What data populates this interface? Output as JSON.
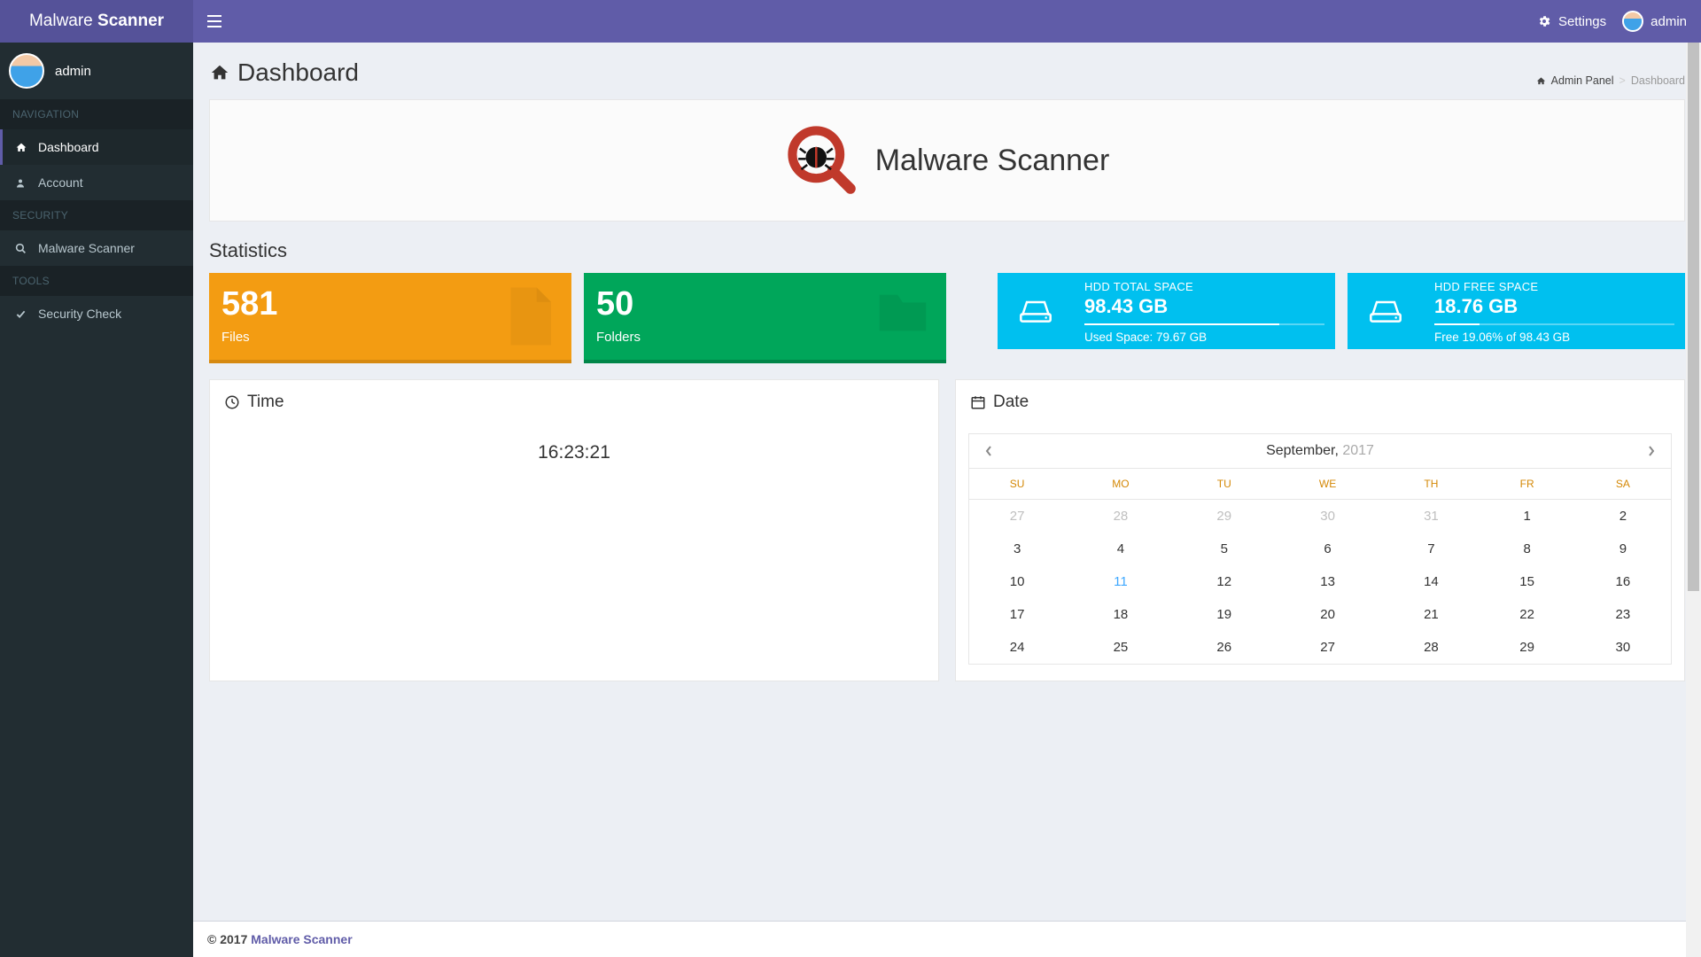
{
  "brand": {
    "part1": "Malware",
    "part2": "Scanner"
  },
  "topbar": {
    "settings": "Settings",
    "user": "admin"
  },
  "sidebar": {
    "user": "admin",
    "headers": {
      "navigation": "NAVIGATION",
      "security": "SECURITY",
      "tools": "TOOLS"
    },
    "items": {
      "dashboard": "Dashboard",
      "account": "Account",
      "malware_scanner": "Malware Scanner",
      "security_check": "Security Check"
    }
  },
  "page": {
    "title": "Dashboard",
    "hero": "Malware Scanner",
    "statistics_label": "Statistics"
  },
  "breadcrumb": {
    "home": "Admin Panel",
    "current": "Dashboard"
  },
  "stats": {
    "files": {
      "value": "581",
      "label": "Files"
    },
    "folders": {
      "value": "50",
      "label": "Folders"
    }
  },
  "disk": {
    "total": {
      "label": "HDD TOTAL SPACE",
      "value": "98.43 GB",
      "footer": "Used Space: 79.67 GB",
      "bar_pct": 81
    },
    "free": {
      "label": "HDD FREE SPACE",
      "value": "18.76 GB",
      "footer": "Free 19.06% of 98.43 GB",
      "bar_pct": 19
    }
  },
  "time_panel": {
    "title": "Time",
    "value": "16:23:21"
  },
  "date_panel": {
    "title": "Date",
    "month": "September,",
    "year": "2017",
    "dow": [
      "SU",
      "MO",
      "TU",
      "WE",
      "TH",
      "FR",
      "SA"
    ],
    "weeks": [
      [
        {
          "d": "27",
          "muted": true
        },
        {
          "d": "28",
          "muted": true
        },
        {
          "d": "29",
          "muted": true
        },
        {
          "d": "30",
          "muted": true
        },
        {
          "d": "31",
          "muted": true
        },
        {
          "d": "1"
        },
        {
          "d": "2"
        }
      ],
      [
        {
          "d": "3"
        },
        {
          "d": "4"
        },
        {
          "d": "5"
        },
        {
          "d": "6"
        },
        {
          "d": "7"
        },
        {
          "d": "8"
        },
        {
          "d": "9"
        }
      ],
      [
        {
          "d": "10"
        },
        {
          "d": "11",
          "today": true
        },
        {
          "d": "12"
        },
        {
          "d": "13"
        },
        {
          "d": "14"
        },
        {
          "d": "15"
        },
        {
          "d": "16"
        }
      ],
      [
        {
          "d": "17"
        },
        {
          "d": "18"
        },
        {
          "d": "19"
        },
        {
          "d": "20"
        },
        {
          "d": "21"
        },
        {
          "d": "22"
        },
        {
          "d": "23"
        }
      ],
      [
        {
          "d": "24"
        },
        {
          "d": "25"
        },
        {
          "d": "26"
        },
        {
          "d": "27"
        },
        {
          "d": "28"
        },
        {
          "d": "29"
        },
        {
          "d": "30"
        }
      ]
    ]
  },
  "footer": {
    "copyright": "© 2017 ",
    "brand": "Malware Scanner"
  }
}
